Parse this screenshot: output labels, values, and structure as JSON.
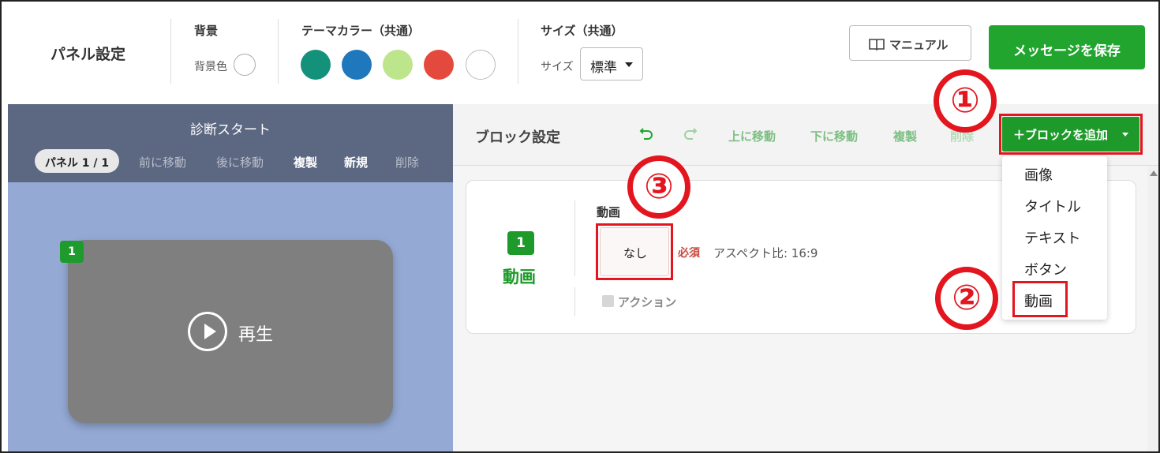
{
  "header": {
    "panel_title": "パネル設定",
    "bg_group_label": "背景",
    "bg_color_label": "背景色",
    "theme_group_label": "テーマカラー（共通）",
    "theme_colors": [
      "#14917a",
      "#1f78bb",
      "#bde58b",
      "#e3493c",
      "#ffffff"
    ],
    "size_group_label": "サイズ（共通）",
    "size_label": "サイズ",
    "size_value": "標準",
    "manual_label": "マニュアル",
    "save_label": "メッセージを保存"
  },
  "preview": {
    "title": "診断スタート",
    "panel_indicator": "パネル 1 / 1",
    "actions": [
      "前に移動",
      "後に移動",
      "複製",
      "新規",
      "削除"
    ],
    "block_number": "1",
    "play_label": "再生"
  },
  "block_settings": {
    "title": "ブロック設定",
    "actions": [
      "上に移動",
      "下に移動",
      "複製",
      "削除"
    ],
    "add_block_label": "＋ブロックを追加",
    "card": {
      "number": "1",
      "type_label": "動画",
      "field_label": "動画",
      "value": "なし",
      "required": "必須",
      "aspect": "アスペクト比: 16:9",
      "action_label": "アクション"
    }
  },
  "dropdown": {
    "items": [
      "画像",
      "タイトル",
      "テキスト",
      "ボタン",
      "動画"
    ]
  },
  "annotations": [
    "①",
    "②",
    "③"
  ]
}
